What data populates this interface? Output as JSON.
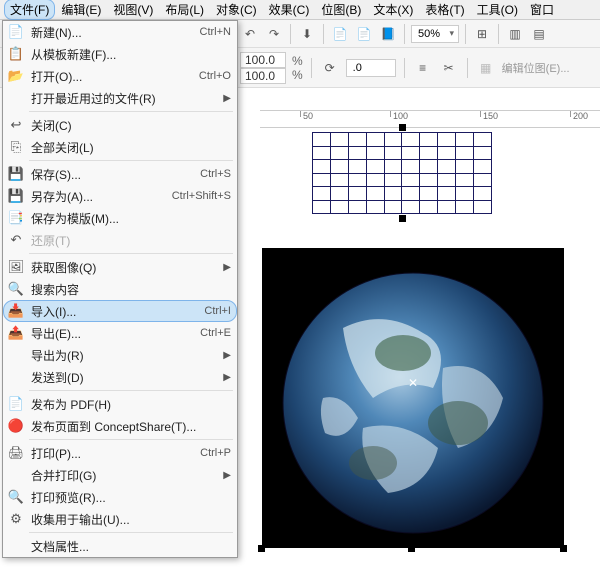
{
  "menubar": [
    "文件(F)",
    "编辑(E)",
    "视图(V)",
    "布局(L)",
    "对象(C)",
    "效果(C)",
    "位图(B)",
    "文本(X)",
    "表格(T)",
    "工具(O)",
    "窗口"
  ],
  "toolbar": {
    "zoom": "50%",
    "pct_a": "100.0",
    "pct_b": "100.0",
    "rotate": ".0",
    "editbmp": "编辑位图(E)..."
  },
  "ruler": [
    "50",
    "100",
    "150",
    "200"
  ],
  "filemenu": [
    {
      "ico": "📄",
      "label": "新建(N)...",
      "sc": "Ctrl+N",
      "int": true
    },
    {
      "ico": "📋",
      "label": "从模板新建(F)...",
      "int": true
    },
    {
      "ico": "📂",
      "label": "打开(O)...",
      "sc": "Ctrl+O",
      "int": true
    },
    {
      "ico": "",
      "label": "打开最近用过的文件(R)",
      "arr": true,
      "int": true
    },
    {
      "sep": true
    },
    {
      "ico": "↩",
      "label": "关闭(C)",
      "int": true
    },
    {
      "ico": "⎘",
      "label": "全部关闭(L)",
      "int": true
    },
    {
      "sep": true
    },
    {
      "ico": "💾",
      "label": "保存(S)...",
      "sc": "Ctrl+S",
      "int": true
    },
    {
      "ico": "💾",
      "label": "另存为(A)...",
      "sc": "Ctrl+Shift+S",
      "int": true
    },
    {
      "ico": "📑",
      "label": "保存为模版(M)...",
      "int": true
    },
    {
      "ico": "↶",
      "label": "还原(T)",
      "int": false,
      "disabled": true
    },
    {
      "sep": true
    },
    {
      "ico": "🖼",
      "label": "获取图像(Q)",
      "arr": true,
      "int": true
    },
    {
      "ico": "🔍",
      "label": "搜索内容",
      "int": true
    },
    {
      "ico": "📥",
      "label": "导入(I)...",
      "sc": "Ctrl+I",
      "int": true,
      "hl": true
    },
    {
      "ico": "📤",
      "label": "导出(E)...",
      "sc": "Ctrl+E",
      "int": true
    },
    {
      "ico": "",
      "label": "导出为(R)",
      "arr": true,
      "int": true
    },
    {
      "ico": "",
      "label": "发送到(D)",
      "arr": true,
      "int": true
    },
    {
      "sep": true
    },
    {
      "ico": "📄",
      "label": "发布为 PDF(H)",
      "int": true
    },
    {
      "ico": "🔴",
      "label": "发布页面到 ConceptShare(T)...",
      "int": true
    },
    {
      "sep": true
    },
    {
      "ico": "🖨",
      "label": "打印(P)...",
      "sc": "Ctrl+P",
      "int": true
    },
    {
      "ico": "",
      "label": "合并打印(G)",
      "arr": true,
      "int": true
    },
    {
      "ico": "🔍",
      "label": "打印预览(R)...",
      "int": true
    },
    {
      "ico": "⚙",
      "label": "收集用于输出(U)...",
      "int": true
    },
    {
      "sep": true
    },
    {
      "ico": "",
      "label": "文档属性...",
      "int": true
    }
  ]
}
